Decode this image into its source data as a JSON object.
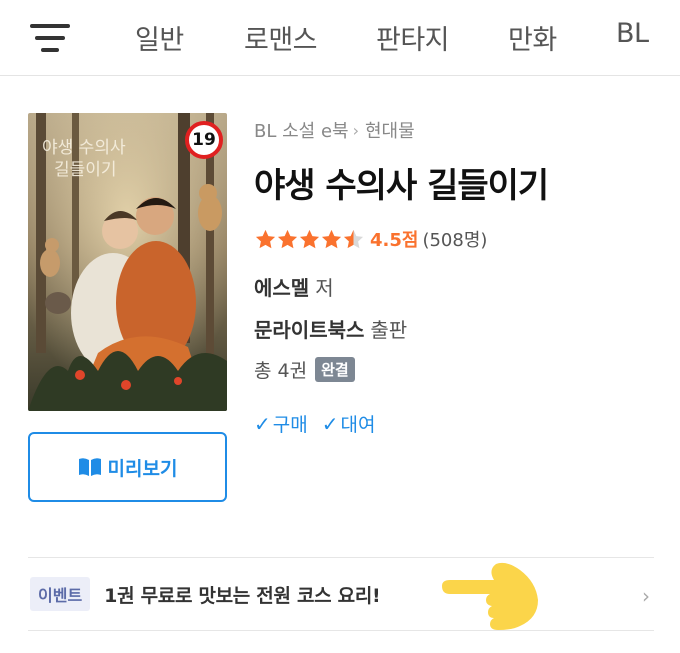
{
  "nav": {
    "tabs": [
      {
        "label": "일반"
      },
      {
        "label": "로맨스"
      },
      {
        "label": "판타지"
      },
      {
        "label": "만화"
      },
      {
        "label": "BL"
      }
    ]
  },
  "book": {
    "age_rating": "19",
    "breadcrumb": {
      "category": "BL 소설 e북",
      "subcategory": "현대물"
    },
    "title": "야생 수의사 길들이기",
    "rating": {
      "stars": 4.5,
      "score_label": "4.5점",
      "count_label": "(508명)"
    },
    "author": {
      "name": "에스멜",
      "suffix": "저"
    },
    "publisher": {
      "name": "문라이트북스",
      "suffix": "출판"
    },
    "volumes": {
      "label": "총 4권",
      "status": "완결"
    },
    "options": [
      {
        "label": "구매"
      },
      {
        "label": "대여"
      }
    ],
    "preview_label": "미리보기"
  },
  "event": {
    "badge": "이벤트",
    "text": "1권 무료로 맛보는 전원 코스 요리!"
  },
  "colors": {
    "accent": "#1f8ce6",
    "star": "#fa722e",
    "age_badge": "#e02020"
  }
}
